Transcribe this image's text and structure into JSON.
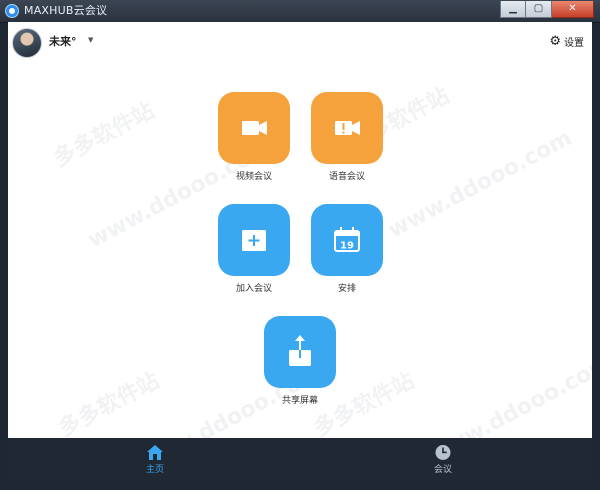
{
  "window": {
    "title": "MAXHUB云会议",
    "minimize": "▁",
    "maximize": "▢",
    "close": "✕"
  },
  "header": {
    "user_name": "未来°",
    "settings_label": "设置"
  },
  "watermark": {
    "cn": "多多软件站",
    "url": "www.ddooo.com"
  },
  "actions": {
    "video_meeting": "视频会议",
    "voice_meeting": "语音会议",
    "join_meeting": "加入会议",
    "schedule": "安排",
    "schedule_calendar_day": "19",
    "share_screen": "共享屏幕"
  },
  "bottom_nav": {
    "home": "主页",
    "meetings": "会议"
  },
  "colors": {
    "orange_tile": "#f5a23c",
    "blue_tile": "#3aa8f0",
    "nav_background": "#1f2833",
    "nav_active": "#3aa8f0"
  }
}
